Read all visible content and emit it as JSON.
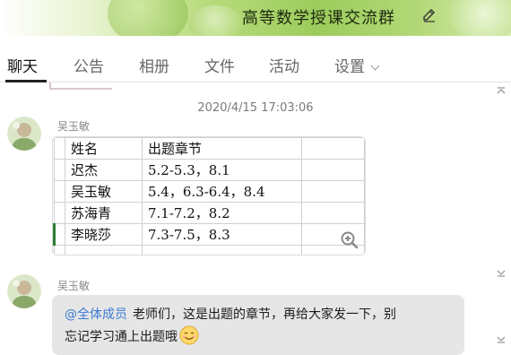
{
  "header": {
    "title": "高等数学授课交流群",
    "edit_icon": "pencil-edit-icon"
  },
  "tabs": [
    {
      "label": "聊天",
      "active": true
    },
    {
      "label": "公告",
      "active": false
    },
    {
      "label": "相册",
      "active": false
    },
    {
      "label": "文件",
      "active": false
    },
    {
      "label": "活动",
      "active": false
    },
    {
      "label": "设置",
      "active": false,
      "has_dropdown": true
    }
  ],
  "chat": {
    "timestamp": "2020/4/15 17:03:06",
    "messages": [
      {
        "sender": "吴玉敏",
        "type": "image-spreadsheet",
        "table": {
          "header": [
            "姓名",
            "出题章节"
          ],
          "rows": [
            [
              "迟杰",
              "5.2-5.3，8.1"
            ],
            [
              "吴玉敏",
              "5.4，6.3-6.4，8.4"
            ],
            [
              "苏海青",
              "7.1-7.2，8.2"
            ],
            [
              "李晓莎",
              "7.3-7.5，8.3"
            ]
          ]
        },
        "zoom_icon": "zoom-in-icon"
      },
      {
        "sender": "吴玉敏",
        "type": "text",
        "mention": "@全体成员",
        "text_line1": "老师们，这是出题的章节，再给大家发一下，别",
        "text_line2": "忘记学习通上出题哦",
        "emoji": "smile-emoji-icon"
      }
    ]
  },
  "colors": {
    "header_green": "#9ccc5c",
    "mention_blue": "#3a7bd5",
    "bubble_gray": "#e6e6e6"
  }
}
